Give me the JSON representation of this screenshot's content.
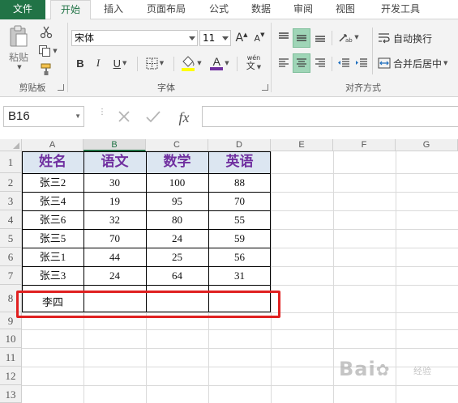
{
  "ribbon": {
    "tabs": [
      {
        "label": "文件",
        "id": "file"
      },
      {
        "label": "开始",
        "id": "home",
        "active": true
      },
      {
        "label": "插入",
        "id": "insert"
      },
      {
        "label": "页面布局",
        "id": "page-layout"
      },
      {
        "label": "公式",
        "id": "formulas"
      },
      {
        "label": "数据",
        "id": "data"
      },
      {
        "label": "审阅",
        "id": "review"
      },
      {
        "label": "视图",
        "id": "view"
      },
      {
        "label": "开发工具",
        "id": "developer"
      }
    ],
    "clipboard": {
      "paste_label": "粘贴",
      "group_label": "剪贴板"
    },
    "font": {
      "font_name": "宋体",
      "font_size": "11",
      "bold": "B",
      "italic": "I",
      "underline": "U",
      "grow_glyph": "A",
      "shrink_glyph": "A",
      "font_color_glyph": "A",
      "phonetic_glyph": "wén",
      "group_label": "字体"
    },
    "alignment": {
      "wrap_text_label": "自动换行",
      "merge_center_label": "合并后居中",
      "group_label": "对齐方式"
    },
    "colors": {
      "file_tab": "#217346",
      "fill_yellow": "#ffff00",
      "font_red": "#c00000",
      "font_purple": "#7030a0"
    }
  },
  "formula_bar": {
    "name_box": "B16",
    "formula": "",
    "fx_label": "fx"
  },
  "sheet": {
    "columns": [
      "A",
      "B",
      "C",
      "D",
      "E",
      "F",
      "G"
    ],
    "selected_column": "B",
    "rows": [
      "1",
      "2",
      "3",
      "4",
      "5",
      "6",
      "7",
      "8",
      "9",
      "10",
      "11",
      "12",
      "13"
    ],
    "header_fill": "#dce6f1",
    "header_text_color": "#7030a0",
    "table": {
      "headers": [
        "姓名",
        "语文",
        "数学",
        "英语"
      ],
      "rows": [
        [
          "张三2",
          "30",
          "100",
          "88"
        ],
        [
          "张三4",
          "19",
          "95",
          "70"
        ],
        [
          "张三6",
          "32",
          "80",
          "55"
        ],
        [
          "张三5",
          "70",
          "24",
          "59"
        ],
        [
          "张三1",
          "44",
          "25",
          "56"
        ],
        [
          "张三3",
          "24",
          "64",
          "31"
        ],
        [
          "李四",
          "",
          "",
          ""
        ]
      ]
    },
    "highlight_color": "#e02020"
  },
  "watermark": {
    "brand": "Bai",
    "suffix": "经验"
  }
}
